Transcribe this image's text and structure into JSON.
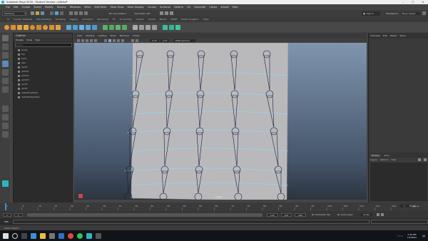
{
  "window": {
    "title": "Autodesk Maya 2018 - Student Version: untitled*",
    "controls": [
      "–",
      "□",
      "✕"
    ]
  },
  "menubar": [
    "File",
    "Edit",
    "Create",
    "Select",
    "Modify",
    "Display",
    "Windows",
    "Mesh",
    "Edit Mesh",
    "Mesh Tools",
    "Mesh Display",
    "Curves",
    "Surfaces",
    "Deform",
    "UV",
    "Generate",
    "Cache",
    "Arnold",
    "Help"
  ],
  "statusline": {
    "mode_dropdown": "Modeling",
    "live_surface": "No Live Surface",
    "symmetry": "Symmetry: Off",
    "signin": "Sign In",
    "workspace_label": "Workspace:",
    "workspace_value": "Maya Classic"
  },
  "shelf_tabs": [
    "Curves / Surfaces",
    "Poly Modeling",
    "Sculpting",
    "Rigging",
    "Animation",
    "Rendering",
    "FX",
    "FX Caching",
    "Custom",
    "Arnold",
    "Bifrost",
    "MASH",
    "Motion Graphics",
    "XGen"
  ],
  "shelf_active": "Poly Modeling",
  "outliner": {
    "title": "Outliner",
    "menu": [
      "Display",
      "Show",
      "Help"
    ],
    "search_placeholder": "Search...",
    "items": [
      "persp",
      "top",
      "front",
      "side",
      "joint2",
      "joint21",
      "joint22",
      "joint23",
      "joint4",
      "joint5",
      "defaultLightSet",
      "defaultObjectSet"
    ]
  },
  "viewport": {
    "menu": [
      "View",
      "Shading",
      "Lighting",
      "Show",
      "Renderer",
      "Panels"
    ],
    "colorspace": "sRGB gamma",
    "values": [
      "0.00",
      "1.00"
    ],
    "camera_label": "persp"
  },
  "channelbox": {
    "tabs": [
      "Channels",
      "Edit",
      "Object",
      "Show"
    ]
  },
  "layerbox": {
    "tabs": [
      "Display",
      "Anim"
    ],
    "menu": [
      "Layers",
      "Options",
      "Help"
    ]
  },
  "timeslider": {
    "ticks": [
      "1",
      "5",
      "10",
      "15",
      "20",
      "25",
      "30",
      "35",
      "40",
      "45",
      "50",
      "55",
      "60",
      "65",
      "70",
      "75",
      "80",
      "85",
      "90",
      "95",
      "100",
      "105",
      "110",
      "115",
      "120"
    ],
    "current_frame": "1"
  },
  "rangeslider": {
    "start": "1",
    "inner_start": "1",
    "inner_end": "120",
    "end": "120",
    "end2": "200",
    "character_set": "No Character Set",
    "anim_layer": "No Anim Layer",
    "fps": "24 fps"
  },
  "command_line": {
    "label": "MEL"
  },
  "help_line": "Select Object",
  "taskbar": {
    "time": "2:44 PM",
    "date": "1/3/2021"
  },
  "colors": {
    "accent": "#7fc7ff",
    "mesh": "#b9b9bc",
    "joint": "#1b1f3a",
    "edgeloop": "#7fe9ff"
  }
}
